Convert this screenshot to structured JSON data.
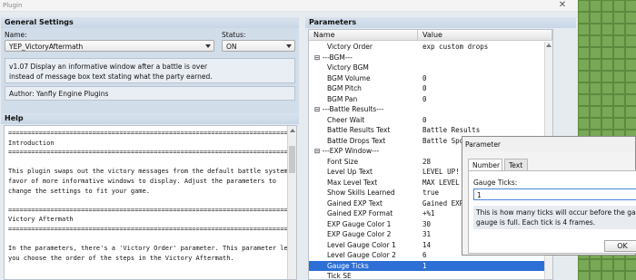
{
  "window": {
    "title": "Plugin",
    "close_glyph": "✕"
  },
  "general": {
    "header": "General Settings",
    "name_label": "Name:",
    "name_value": "YEP_VictoryAftermath",
    "status_label": "Status:",
    "status_value": "ON",
    "description": "v1.07 Display an informative window after a battle is over\ninstead of message box text stating what the party earned.",
    "author": "Author: Yanfly Engine Plugins"
  },
  "help": {
    "header": "Help",
    "text": "==========================================================================\nIntroduction\n==========================================================================\n\nThis plugin swaps out the victory messages from the default battle system in\nfavor of more informative windows to display. Adjust the parameters to\nchange the settings to fit your game.\n\n==========================================================================\nVictory Aftermath\n==========================================================================\n\nIn the parameters, there's a 'Victory Order' parameter. This parameter lets\nyou choose the order of the steps in the Victory Aftermath."
  },
  "parameters": {
    "header": "Parameters",
    "col_name": "Name",
    "col_value": "Value",
    "rows": [
      {
        "name": "Victory Order",
        "value": "exp custom drops",
        "category": false
      },
      {
        "name": "---BGM---",
        "value": "",
        "category": true
      },
      {
        "name": "Victory BGM",
        "value": "",
        "category": false
      },
      {
        "name": "BGM Volume",
        "value": "0",
        "category": false
      },
      {
        "name": "BGM Pitch",
        "value": "0",
        "category": false
      },
      {
        "name": "BGM Pan",
        "value": "0",
        "category": false
      },
      {
        "name": "---Battle Results---",
        "value": "",
        "category": true
      },
      {
        "name": "Cheer Wait",
        "value": "0",
        "category": false
      },
      {
        "name": "Battle Results Text",
        "value": "Battle Results",
        "category": false
      },
      {
        "name": "Battle Drops Text",
        "value": "Battle Spoils",
        "category": false
      },
      {
        "name": "---EXP Window---",
        "value": "",
        "category": true
      },
      {
        "name": "Font Size",
        "value": "28",
        "category": false
      },
      {
        "name": "Level Up Text",
        "value": "LEVEL UP!",
        "category": false
      },
      {
        "name": "Max Level Text",
        "value": "MAX LEVEL",
        "category": false
      },
      {
        "name": "Show Skills Learned",
        "value": "true",
        "category": false
      },
      {
        "name": "Gained EXP Text",
        "value": "Gained EXP",
        "category": false
      },
      {
        "name": "Gained EXP Format",
        "value": "+%1",
        "category": false
      },
      {
        "name": "EXP Gauge Color 1",
        "value": "30",
        "category": false
      },
      {
        "name": "EXP Gauge Color 2",
        "value": "31",
        "category": false
      },
      {
        "name": "Level Gauge Color 1",
        "value": "14",
        "category": false
      },
      {
        "name": "Level Gauge Color 2",
        "value": "6",
        "category": false
      },
      {
        "name": "Gauge Ticks",
        "value": "1",
        "category": false,
        "selected": true
      },
      {
        "name": "Tick SE",
        "value": "",
        "category": false
      }
    ]
  },
  "popup": {
    "title": "Parameter",
    "tabs": [
      "Number",
      "Text"
    ],
    "field_label": "Gauge Ticks:",
    "field_value": "1",
    "description": "This is how many ticks will occur before the gauge\ngauge is full. Each tick is 4 frames.",
    "ok_label": "OK"
  },
  "colors": {
    "selection": "#2e6fd6",
    "panel_header": "#c8d6e6",
    "map_grass": "#79a856"
  }
}
